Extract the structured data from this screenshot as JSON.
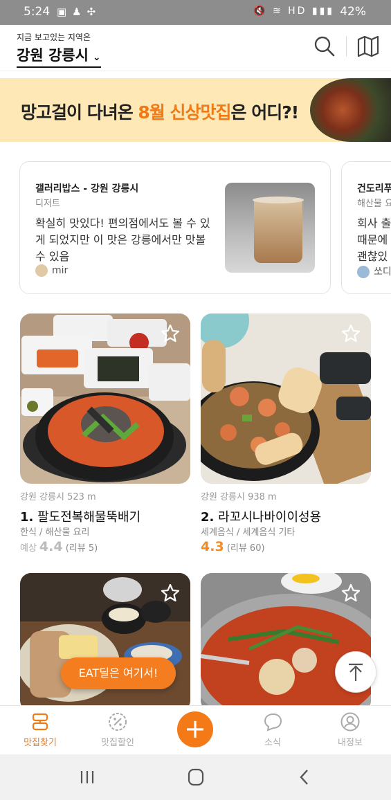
{
  "status": {
    "time": "5:24",
    "battery": "42%",
    "network": "HD"
  },
  "header": {
    "caption": "지금 보고있는 지역은",
    "region": "강원 강릉시"
  },
  "banner": {
    "text_before": "망고걸이 다녀온 ",
    "text_highlight": "8월 신상맛집",
    "text_after": "은 어디?!"
  },
  "reviews": [
    {
      "title": "갤러리밥스 - 강원 강릉시",
      "category": "디저트",
      "body": "확실히 맛있다! 편의점에서도 볼 수 있게 되었지만 이 맛은 강릉에서만 맛볼 수 있음",
      "user": "mir"
    },
    {
      "title": "건도리푸",
      "category": "해산물 요",
      "body": "회사 출 때문에 괜찮있",
      "user": "쏘디"
    }
  ],
  "restaurants": [
    {
      "distance": "강원 강릉시 523 m",
      "rank": "1.",
      "name": "팔도전복해물뚝배기",
      "category": "한식 / 해산물 요리",
      "rating_prefix": "예상",
      "rating": "4.4",
      "reviews": "(리뷰 5)"
    },
    {
      "distance": "강원 강릉시 938 m",
      "rank": "2.",
      "name": "라꼬시나바이이성용",
      "category": "세계음식 / 세계음식 기타",
      "rating_prefix": "",
      "rating": "4.3",
      "reviews": "(리뷰 60)"
    }
  ],
  "eat_deal_label": "EAT딜은 여기서!",
  "tabs": [
    {
      "label": "맛집찾기",
      "icon": "map-pin-icon"
    },
    {
      "label": "맛집할인",
      "icon": "discount-icon"
    },
    {
      "label": "소식",
      "icon": "chat-bubble-icon"
    },
    {
      "label": "내정보",
      "icon": "profile-icon"
    }
  ],
  "colors": {
    "accent": "#f47d20",
    "banner_bg": "#fde8b6"
  }
}
